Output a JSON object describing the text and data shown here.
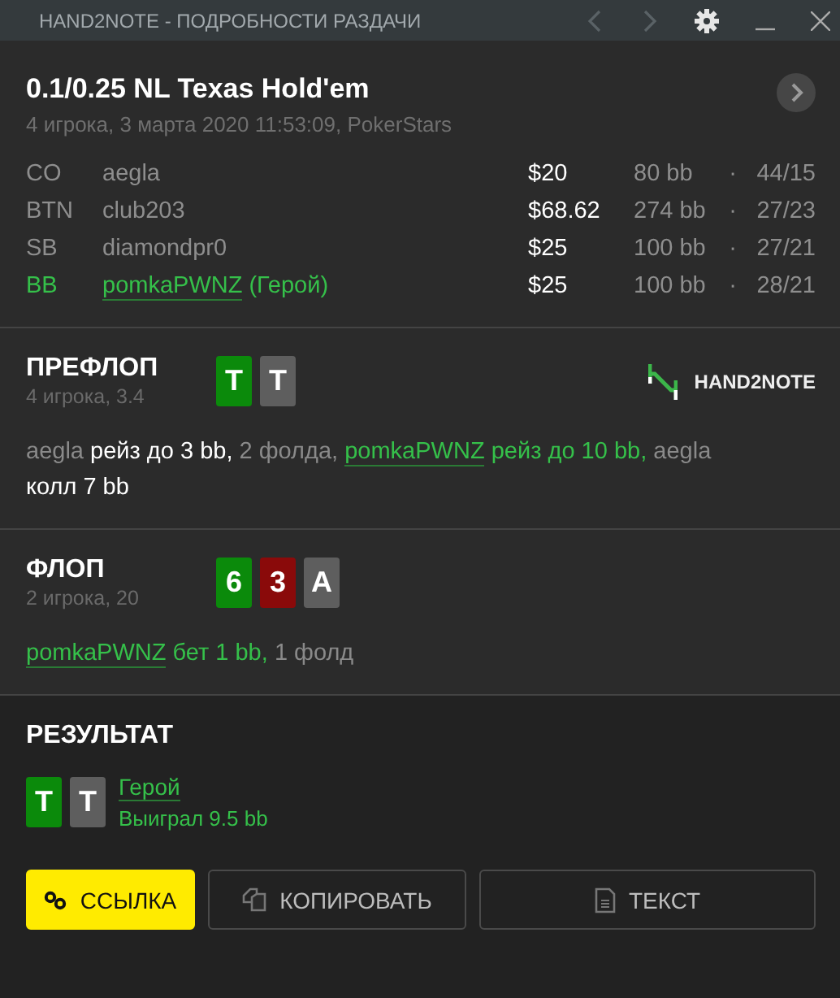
{
  "window": {
    "title": "HAND2NOTE - ПОДРОБНОСТИ РАЗДАЧИ"
  },
  "hand": {
    "title": "0.1/0.25 NL Texas Hold'em",
    "subtitle": "4 игрока, 3 марта 2020 11:53:09, PokerStars"
  },
  "players": [
    {
      "position": "CO",
      "name": "aegla",
      "stack": "$20",
      "bb": "80 bb",
      "separator": "·",
      "stats": "44/15",
      "hero": false
    },
    {
      "position": "BTN",
      "name": "club203",
      "stack": "$68.62",
      "bb": "274 bb",
      "separator": "·",
      "stats": "27/23",
      "hero": false
    },
    {
      "position": "SB",
      "name": "diamondpr0",
      "stack": "$25",
      "bb": "100 bb",
      "separator": "·",
      "stats": "27/21",
      "hero": false
    },
    {
      "position": "BB",
      "name": "pomkaPWNZ",
      "hero_label": "(Герой)",
      "stack": "$25",
      "bb": "100 bb",
      "separator": "·",
      "stats": "28/21",
      "hero": true
    }
  ],
  "streets": [
    {
      "name": "ПРЕФЛОП",
      "info": "4 игрока, 3.4",
      "logo": "HAND**2**NOTE",
      "cards": [
        {
          "rank": "T",
          "color": "#0b8a0b"
        },
        {
          "rank": "T",
          "color": "#5e5e5e"
        }
      ],
      "actions": [
        {
          "text": "aegla",
          "kind": "player",
          "hero": false
        },
        {
          "text": "рейз до 3 bb,",
          "kind": "action",
          "hero": false
        },
        {
          "text": "2 фолда,",
          "kind": "plain",
          "hero": false
        },
        {
          "text": "pomkaPWNZ",
          "kind": "player",
          "hero": true
        },
        {
          "text": "рейз до 10 bb,",
          "kind": "action",
          "hero": true
        },
        {
          "text": "aegla",
          "kind": "player",
          "hero": false
        },
        {
          "text": "колл 7 bb",
          "kind": "action",
          "hero": false
        }
      ]
    },
    {
      "name": "ФЛОП",
      "info": "2 игрока, 20",
      "cards": [
        {
          "rank": "6",
          "color": "#0b8a0b"
        },
        {
          "rank": "3",
          "color": "#8a0a0a"
        },
        {
          "rank": "A",
          "color": "#5e5e5e"
        }
      ],
      "actions": [
        {
          "text": "pomkaPWNZ",
          "kind": "player",
          "hero": true
        },
        {
          "text": "бет 1 bb,",
          "kind": "action",
          "hero": true
        },
        {
          "text": "1 фолд",
          "kind": "plain",
          "hero": false
        }
      ]
    }
  ],
  "result": {
    "title": "РЕЗУЛЬТАТ",
    "cards": [
      {
        "rank": "T",
        "color": "#0b8a0b"
      },
      {
        "rank": "T",
        "color": "#5e5e5e"
      }
    ],
    "winner": "Герой",
    "outcome": "Выиграл 9.5 bb"
  },
  "buttons": [
    {
      "label": "ССЫЛКА",
      "kind": "link",
      "primary": true
    },
    {
      "label": "КОПИРОВАТЬ",
      "kind": "copy",
      "primary": false
    },
    {
      "label": "ТЕКСТ",
      "kind": "text",
      "primary": false
    }
  ]
}
